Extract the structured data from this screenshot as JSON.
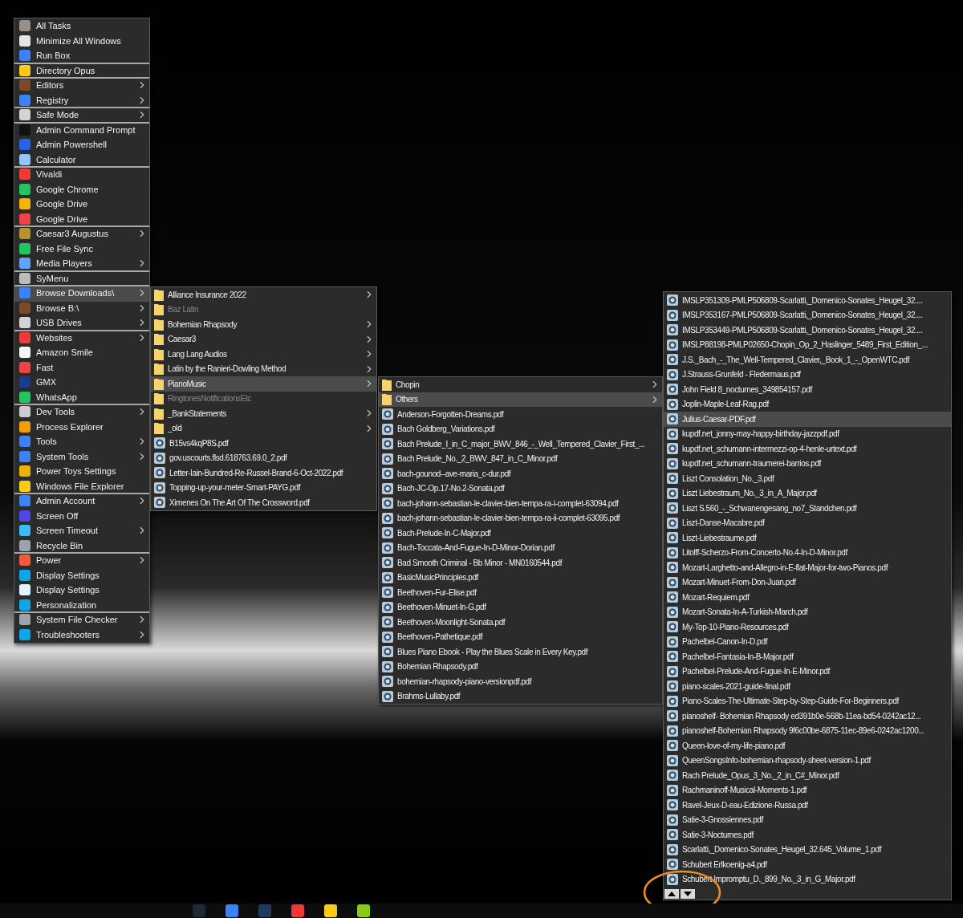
{
  "menus": [
    {
      "items": [
        {
          "label": "All Tasks",
          "submenu": false,
          "selected": false,
          "divider": false
        },
        {
          "label": "Minimize All Windows",
          "submenu": false,
          "selected": false,
          "divider": false
        },
        {
          "label": "Run Box",
          "submenu": false,
          "selected": false,
          "divider": true
        },
        {
          "label": "Directory Opus",
          "submenu": false,
          "selected": false,
          "divider": true
        },
        {
          "label": "Editors",
          "submenu": true,
          "selected": false,
          "divider": false
        },
        {
          "label": "Registry",
          "submenu": true,
          "selected": false,
          "divider": true
        },
        {
          "label": "Safe Mode",
          "submenu": true,
          "selected": false,
          "divider": true
        },
        {
          "label": "Admin Command Prompt",
          "submenu": false,
          "selected": false,
          "divider": false
        },
        {
          "label": "Admin Powershell",
          "submenu": false,
          "selected": false,
          "divider": false
        },
        {
          "label": "Calculator",
          "submenu": false,
          "selected": false,
          "divider": true
        },
        {
          "label": "Vivaldi",
          "submenu": false,
          "selected": false,
          "divider": false
        },
        {
          "label": "Google Chrome",
          "submenu": false,
          "selected": false,
          "divider": false
        },
        {
          "label": "Google Drive",
          "submenu": false,
          "selected": false,
          "divider": false
        },
        {
          "label": "Google Drive",
          "submenu": false,
          "selected": false,
          "divider": true
        },
        {
          "label": "Caesar3 Augustus",
          "submenu": true,
          "selected": false,
          "divider": false
        },
        {
          "label": "Free File Sync",
          "submenu": false,
          "selected": false,
          "divider": false
        },
        {
          "label": "Media Players",
          "submenu": true,
          "selected": false,
          "divider": true
        },
        {
          "label": "SyMenu",
          "submenu": false,
          "selected": false,
          "divider": true
        },
        {
          "label": "Browse Downloads\\",
          "submenu": true,
          "selected": true,
          "divider": false
        },
        {
          "label": "Browse B:\\",
          "submenu": true,
          "selected": false,
          "divider": false
        },
        {
          "label": "USB Drives",
          "submenu": true,
          "selected": false,
          "divider": true
        },
        {
          "label": "Websites",
          "submenu": true,
          "selected": false,
          "divider": false
        },
        {
          "label": "Amazon Smile",
          "submenu": false,
          "selected": false,
          "divider": false
        },
        {
          "label": "Fast",
          "submenu": false,
          "selected": false,
          "divider": false
        },
        {
          "label": "GMX",
          "submenu": false,
          "selected": false,
          "divider": false
        },
        {
          "label": "WhatsApp",
          "submenu": false,
          "selected": false,
          "divider": true
        },
        {
          "label": "Dev Tools",
          "submenu": true,
          "selected": false,
          "divider": false
        },
        {
          "label": "Process Explorer",
          "submenu": false,
          "selected": false,
          "divider": false
        },
        {
          "label": "Tools",
          "submenu": true,
          "selected": false,
          "divider": false
        },
        {
          "label": "System Tools",
          "submenu": true,
          "selected": false,
          "divider": false
        },
        {
          "label": "Power Toys Settings",
          "submenu": false,
          "selected": false,
          "divider": false
        },
        {
          "label": "Windows File Explorer",
          "submenu": false,
          "selected": false,
          "divider": true
        },
        {
          "label": "Admin Account",
          "submenu": true,
          "selected": false,
          "divider": false
        },
        {
          "label": "Screen Off",
          "submenu": false,
          "selected": false,
          "divider": false
        },
        {
          "label": "Screen Timeout",
          "submenu": true,
          "selected": false,
          "divider": false
        },
        {
          "label": "Recycle Bin",
          "submenu": false,
          "selected": false,
          "divider": true
        },
        {
          "label": "Power",
          "submenu": true,
          "selected": false,
          "divider": false
        },
        {
          "label": "Display Settings",
          "submenu": false,
          "selected": false,
          "divider": false
        },
        {
          "label": "Display Settings",
          "submenu": false,
          "selected": false,
          "divider": false
        },
        {
          "label": "Personalization",
          "submenu": false,
          "selected": false,
          "divider": true
        },
        {
          "label": "System File Checker",
          "submenu": true,
          "selected": false,
          "divider": false
        },
        {
          "label": "Troubleshooters",
          "submenu": true,
          "selected": false,
          "divider": false
        }
      ]
    },
    {
      "items": [
        {
          "label": "Alliance Insurance 2022",
          "kind": "folder",
          "submenu": true,
          "selected": false,
          "disabled": false
        },
        {
          "label": "Baz Latin",
          "kind": "folder",
          "submenu": false,
          "selected": false,
          "disabled": true
        },
        {
          "label": "Bohemian Rhapsody",
          "kind": "folder",
          "submenu": true,
          "selected": false,
          "disabled": false
        },
        {
          "label": "Caesar3",
          "kind": "folder",
          "submenu": true,
          "selected": false,
          "disabled": false
        },
        {
          "label": "Lang Lang Audios",
          "kind": "folder",
          "submenu": true,
          "selected": false,
          "disabled": false
        },
        {
          "label": "Latin by the Ranieri-Dowling Method",
          "kind": "folder",
          "submenu": true,
          "selected": false,
          "disabled": false
        },
        {
          "label": "PianoMusic",
          "kind": "folder",
          "submenu": true,
          "selected": true,
          "disabled": false
        },
        {
          "label": "RingtonesNotificationsEtc",
          "kind": "folder",
          "submenu": false,
          "selected": false,
          "disabled": true
        },
        {
          "label": "_BankStatements",
          "kind": "folder",
          "submenu": true,
          "selected": false,
          "disabled": false
        },
        {
          "label": "_old",
          "kind": "folder",
          "submenu": true,
          "selected": false,
          "disabled": false
        },
        {
          "label": "B15vs4kqP8S.pdf",
          "kind": "pdf",
          "submenu": false,
          "selected": false,
          "disabled": false
        },
        {
          "label": "gov.uscourts.flsd.618763.69.0_2.pdf",
          "kind": "pdf",
          "submenu": false,
          "selected": false,
          "disabled": false
        },
        {
          "label": "Letter-Iain-Bundred-Re-Russel-Brand-6-Oct-2022.pdf",
          "kind": "pdf",
          "submenu": false,
          "selected": false,
          "disabled": false
        },
        {
          "label": "Topping-up-your-meter-Smart-PAYG.pdf",
          "kind": "pdf",
          "submenu": false,
          "selected": false,
          "disabled": false
        },
        {
          "label": "Ximenes On The Art Of The Crossword.pdf",
          "kind": "pdf",
          "submenu": false,
          "selected": false,
          "disabled": false
        }
      ]
    },
    {
      "items": [
        {
          "label": "Chopin",
          "kind": "folder",
          "submenu": true,
          "selected": false
        },
        {
          "label": "Others",
          "kind": "folder",
          "submenu": true,
          "selected": true
        },
        {
          "label": "Anderson-Forgotten-Dreams.pdf",
          "kind": "pdf",
          "submenu": false,
          "selected": false
        },
        {
          "label": "Bach Goldberg_Variations.pdf",
          "kind": "pdf",
          "submenu": false,
          "selected": false
        },
        {
          "label": "Bach Prelude_I_in_C_major_BWV_846_-_Well_Tempered_Clavier_First_...",
          "kind": "pdf",
          "submenu": false,
          "selected": false
        },
        {
          "label": "Bach Prelude_No._2_BWV_847_in_C_Minor.pdf",
          "kind": "pdf",
          "submenu": false,
          "selected": false
        },
        {
          "label": "bach-gounod--ave-maria_c-dur.pdf",
          "kind": "pdf",
          "submenu": false,
          "selected": false
        },
        {
          "label": "Bach-JC-Op.17-No.2-Sonata.pdf",
          "kind": "pdf",
          "submenu": false,
          "selected": false
        },
        {
          "label": "bach-johann-sebastian-le-clavier-bien-tempa-ra-i-complet-63094.pdf",
          "kind": "pdf",
          "submenu": false,
          "selected": false
        },
        {
          "label": "bach-johann-sebastian-le-clavier-bien-tempa-ra-ii-complet-63095.pdf",
          "kind": "pdf",
          "submenu": false,
          "selected": false
        },
        {
          "label": "Bach-Prelude-In-C-Major.pdf",
          "kind": "pdf",
          "submenu": false,
          "selected": false
        },
        {
          "label": "Bach-Toccata-And-Fugue-In-D-Minor-Dorian.pdf",
          "kind": "pdf",
          "submenu": false,
          "selected": false
        },
        {
          "label": "Bad  Smooth Criminal - Bb Minor - MN0160544.pdf",
          "kind": "pdf",
          "submenu": false,
          "selected": false
        },
        {
          "label": "BasicMusicPrinciples.pdf",
          "kind": "pdf",
          "submenu": false,
          "selected": false
        },
        {
          "label": "Beethoven-Fur-Elise.pdf",
          "kind": "pdf",
          "submenu": false,
          "selected": false
        },
        {
          "label": "Beethoven-Minuet-In-G.pdf",
          "kind": "pdf",
          "submenu": false,
          "selected": false
        },
        {
          "label": "Beethoven-Moonlight-Sonata.pdf",
          "kind": "pdf",
          "submenu": false,
          "selected": false
        },
        {
          "label": "Beethoven-Pathetique.pdf",
          "kind": "pdf",
          "submenu": false,
          "selected": false
        },
        {
          "label": "Blues Piano Ebook - Play the Blues Scale in Every Key.pdf",
          "kind": "pdf",
          "submenu": false,
          "selected": false
        },
        {
          "label": "Bohemian Rhapsody.pdf",
          "kind": "pdf",
          "submenu": false,
          "selected": false
        },
        {
          "label": "bohemian-rhapsody-piano-versionpdf.pdf",
          "kind": "pdf",
          "submenu": false,
          "selected": false
        },
        {
          "label": "Brahms-Lullaby.pdf",
          "kind": "pdf",
          "submenu": false,
          "selected": false
        }
      ]
    },
    {
      "items": [
        {
          "label": "IMSLP351309-PMLP506809-Scarlatti,_Domenico-Sonates_Heugel_32....",
          "kind": "pdf",
          "submenu": false,
          "selected": false
        },
        {
          "label": "IMSLP353167-PMLP506809-Scarlatti,_Domenico-Sonates_Heugel_32....",
          "kind": "pdf",
          "submenu": false,
          "selected": false
        },
        {
          "label": "IMSLP353449-PMLP506809-Scarlatti,_Domenico-Sonates_Heugel_32....",
          "kind": "pdf",
          "submenu": false,
          "selected": false
        },
        {
          "label": "IMSLP88198-PMLP02650-Chopin_Op_2_Haslinger_5489_First_Edition_...",
          "kind": "pdf",
          "submenu": false,
          "selected": false
        },
        {
          "label": "J.S._Bach_-_The_Well-Tempered_Clavier,_Book_1_-_OpenWTC.pdf",
          "kind": "pdf",
          "submenu": false,
          "selected": false
        },
        {
          "label": "J.Strauss-Grunfeld - Fledermaus.pdf",
          "kind": "pdf",
          "submenu": false,
          "selected": false
        },
        {
          "label": "John Field 8_nocturnes_349854157.pdf",
          "kind": "pdf",
          "submenu": false,
          "selected": false
        },
        {
          "label": "Joplin-Maple-Leaf-Rag.pdf",
          "kind": "pdf",
          "submenu": false,
          "selected": false
        },
        {
          "label": "Julius-Caesar-PDF.pdf",
          "kind": "pdf",
          "submenu": false,
          "selected": true
        },
        {
          "label": "kupdf.net_jonny-may-happy-birthday-jazzpdf.pdf",
          "kind": "pdf",
          "submenu": false,
          "selected": false
        },
        {
          "label": "kupdf.net_schumann-intermezzi-op-4-henle-urtext.pdf",
          "kind": "pdf",
          "submenu": false,
          "selected": false
        },
        {
          "label": "kupdf.net_schumann-traumerei-barrios.pdf",
          "kind": "pdf",
          "submenu": false,
          "selected": false
        },
        {
          "label": "Liszt Consolation_No._3.pdf",
          "kind": "pdf",
          "submenu": false,
          "selected": false
        },
        {
          "label": "Liszt Liebestraum_No._3_in_A_Major.pdf",
          "kind": "pdf",
          "submenu": false,
          "selected": false
        },
        {
          "label": "Liszt S.560_-_Schwanengesang_no7_Standchen.pdf",
          "kind": "pdf",
          "submenu": false,
          "selected": false
        },
        {
          "label": "Liszt-Danse-Macabre.pdf",
          "kind": "pdf",
          "submenu": false,
          "selected": false
        },
        {
          "label": "Liszt-Liebestraume.pdf",
          "kind": "pdf",
          "submenu": false,
          "selected": false
        },
        {
          "label": "Litolff-Scherzo-From-Concerto-No.4-In-D-Minor.pdf",
          "kind": "pdf",
          "submenu": false,
          "selected": false
        },
        {
          "label": "Mozart-Larghetto-and-Allegro-in-E-flat-Major-for-two-Pianos.pdf",
          "kind": "pdf",
          "submenu": false,
          "selected": false
        },
        {
          "label": "Mozart-Minuet-From-Don-Juan.pdf",
          "kind": "pdf",
          "submenu": false,
          "selected": false
        },
        {
          "label": "Mozart-Requiem.pdf",
          "kind": "pdf",
          "submenu": false,
          "selected": false
        },
        {
          "label": "Mozart-Sonata-In-A-Turkish-March.pdf",
          "kind": "pdf",
          "submenu": false,
          "selected": false
        },
        {
          "label": "My-Top-10-Piano-Resources.pdf",
          "kind": "pdf",
          "submenu": false,
          "selected": false
        },
        {
          "label": "Pachelbel-Canon-In-D.pdf",
          "kind": "pdf",
          "submenu": false,
          "selected": false
        },
        {
          "label": "Pachelbel-Fantasia-In-B-Major.pdf",
          "kind": "pdf",
          "submenu": false,
          "selected": false
        },
        {
          "label": "Pachelbel-Prelude-And-Fugue-In-E-Minor.pdf",
          "kind": "pdf",
          "submenu": false,
          "selected": false
        },
        {
          "label": "piano-scales-2021-guide-final.pdf",
          "kind": "pdf",
          "submenu": false,
          "selected": false
        },
        {
          "label": "Piano-Scales-The-Ultimate-Step-by-Step-Guide-For-Beginners.pdf",
          "kind": "pdf",
          "submenu": false,
          "selected": false
        },
        {
          "label": "pianoshelf- Bohemian Rhapsody ed391b0e-568b-11ea-bd54-0242ac12...",
          "kind": "pdf",
          "submenu": false,
          "selected": false
        },
        {
          "label": "pianoshelf-Bohemian Rhapsody 9f6c00be-6875-11ec-89e6-0242ac1200...",
          "kind": "pdf",
          "submenu": false,
          "selected": false
        },
        {
          "label": "Queen-love-of-my-life-piano.pdf",
          "kind": "pdf",
          "submenu": false,
          "selected": false
        },
        {
          "label": "QueenSongsInfo-bohemian-rhapsody-sheet-version-1.pdf",
          "kind": "pdf",
          "submenu": false,
          "selected": false
        },
        {
          "label": "Rach Prelude_Opus_3_No._2_in_C#_Minor.pdf",
          "kind": "pdf",
          "submenu": false,
          "selected": false
        },
        {
          "label": "Rachmaninoff-Musical-Moments-1.pdf",
          "kind": "pdf",
          "submenu": false,
          "selected": false
        },
        {
          "label": "Ravel-Jeux-D-eau-Edizione-Russa.pdf",
          "kind": "pdf",
          "submenu": false,
          "selected": false
        },
        {
          "label": "Satie-3-Gnossiennes.pdf",
          "kind": "pdf",
          "submenu": false,
          "selected": false
        },
        {
          "label": "Satie-3-Nocturnes.pdf",
          "kind": "pdf",
          "submenu": false,
          "selected": false
        },
        {
          "label": "Scarlatti,_Domenico-Sonates_Heugel_32.645_Volume_1.pdf",
          "kind": "pdf",
          "submenu": false,
          "selected": false
        },
        {
          "label": "Schubert Erlkoenig-a4.pdf",
          "kind": "pdf",
          "submenu": false,
          "selected": false
        },
        {
          "label": "Schubert Impromptu_D._899_No._3_in_G_Major.pdf",
          "kind": "pdf",
          "submenu": false,
          "selected": false
        }
      ]
    }
  ]
}
